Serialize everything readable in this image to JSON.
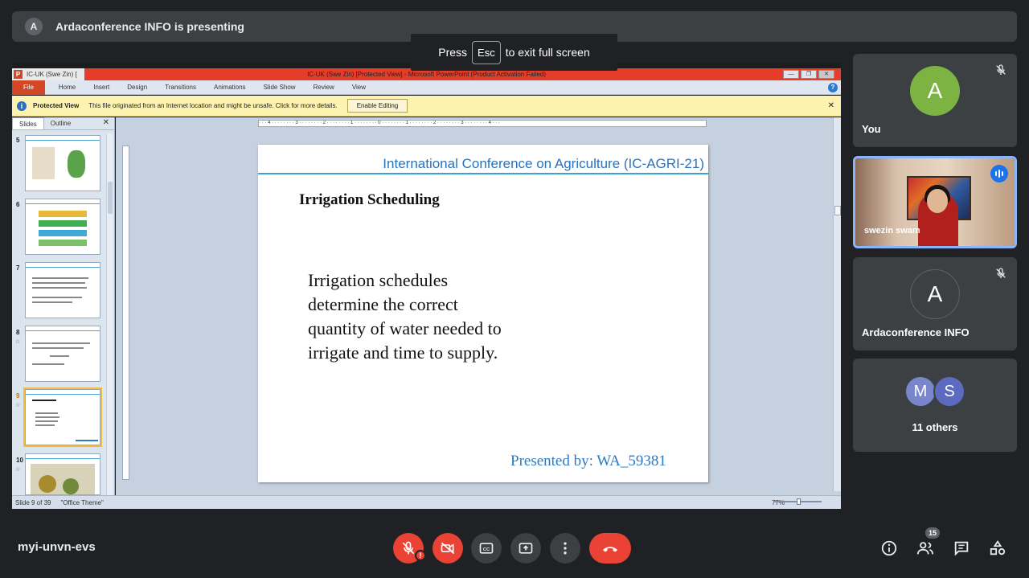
{
  "presenting_bar": {
    "avatar_letter": "A",
    "text": "Ardaconference INFO is presenting"
  },
  "fullscreen_toast": {
    "before": "Press",
    "key": "Esc",
    "after": "to exit full screen"
  },
  "powerpoint": {
    "window_tab": "IC-UK (Swe Zin) [",
    "window_title": "IC-UK (Swe Zin) [Protected View] - Microsoft PowerPoint (Product Activation Failed)",
    "ribbon_tabs": [
      "File",
      "Home",
      "Insert",
      "Design",
      "Transitions",
      "Animations",
      "Slide Show",
      "Review",
      "View"
    ],
    "protected_view": {
      "label": "Protected View",
      "message": "This file originated from an Internet location and might be unsafe. Click for more details.",
      "button": "Enable Editing"
    },
    "panel_tabs": [
      "Slides",
      "Outline"
    ],
    "thumbnails": [
      "5",
      "6",
      "7",
      "8",
      "9",
      "10"
    ],
    "ruler_text": "· · · 4 · · · · · · · · 3 · · · · · · · · 2 · · · · · · · · 1 · · · · · · · · 0 · · · · · · · · 1 · · · · · · · · 2 · · · · · · · · 3 · · · · · · · · 4 · · ·",
    "slide": {
      "header": "International Conference on Agriculture (IC-AGRI-21)",
      "title": "Irrigation Scheduling",
      "body": "Irrigation schedules determine the correct quantity of water needed to irrigate and time to supply.",
      "presenter": "Presented by:  WA_59381"
    },
    "status": {
      "slide_count": "Slide 9 of 39",
      "theme": "\"Office Theme\"",
      "zoom": "77%"
    }
  },
  "participants": [
    {
      "name": "You",
      "letter": "A",
      "color": "#7cb342"
    },
    {
      "name": "swezin swam"
    },
    {
      "name": "Ardaconference INFO",
      "letter": "A",
      "color": "#3c4043"
    },
    {
      "others": "11 others",
      "letters": [
        "M",
        "S"
      ],
      "colors": [
        "#7986cb",
        "#5c6bc0"
      ]
    }
  ],
  "bottom_bar": {
    "meeting_code": "myi-unvn-evs",
    "people_count": "15",
    "mic_alert": "!"
  }
}
